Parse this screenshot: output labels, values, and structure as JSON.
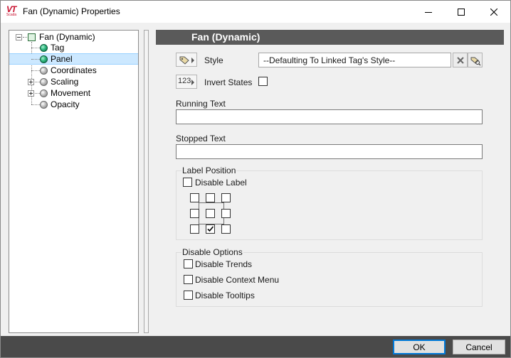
{
  "window": {
    "title": "Fan (Dynamic) Properties",
    "logo_text": "VT",
    "logo_sub": "Scada"
  },
  "tree": {
    "root": "Fan (Dynamic)",
    "items": [
      {
        "label": "Tag",
        "state": "green",
        "selected": false,
        "expandable": false
      },
      {
        "label": "Panel",
        "state": "green",
        "selected": true,
        "expandable": false
      },
      {
        "label": "Coordinates",
        "state": "gray",
        "selected": false,
        "expandable": false
      },
      {
        "label": "Scaling",
        "state": "gray",
        "selected": false,
        "expandable": true
      },
      {
        "label": "Movement",
        "state": "gray",
        "selected": false,
        "expandable": true
      },
      {
        "label": "Opacity",
        "state": "gray",
        "selected": false,
        "expandable": false
      }
    ]
  },
  "panel": {
    "header": "Fan (Dynamic)",
    "style": {
      "label": "Style",
      "value": "--Defaulting To Linked Tag's Style--"
    },
    "invert": {
      "icon_text": "123",
      "label": "Invert States",
      "checked": false
    },
    "running_text": {
      "label": "Running Text",
      "value": ""
    },
    "stopped_text": {
      "label": "Stopped Text",
      "value": ""
    },
    "label_position": {
      "title": "Label Position",
      "disable_label": "Disable Label",
      "selected": "bottom-center"
    },
    "disable_options": {
      "title": "Disable Options",
      "trends": "Disable Trends",
      "context_menu": "Disable Context Menu",
      "tooltips": "Disable Tooltips"
    }
  },
  "footer": {
    "ok": "OK",
    "cancel": "Cancel"
  },
  "colors": {
    "header_bg": "#5a5a5a",
    "footer_bg": "#4a4a4a",
    "selection": "#cce8ff",
    "accent": "#0078d7"
  }
}
